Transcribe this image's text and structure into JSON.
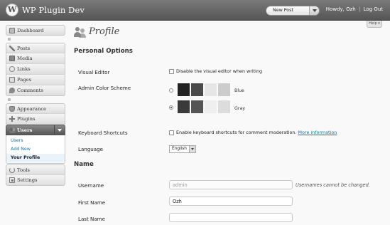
{
  "header": {
    "site_title": "WP Plugin Dev",
    "favorite_action": "New Post",
    "greeting": "Howdy,",
    "user_name": "Ozh",
    "separator": "|",
    "logout": "Log Out",
    "help_tab": "Help"
  },
  "sidebar": {
    "items": [
      {
        "label": "Dashboard",
        "icon": "dashboard-icon"
      },
      {
        "label": "Posts",
        "icon": "posts-icon"
      },
      {
        "label": "Media",
        "icon": "media-icon"
      },
      {
        "label": "Links",
        "icon": "links-icon"
      },
      {
        "label": "Pages",
        "icon": "pages-icon"
      },
      {
        "label": "Comments",
        "icon": "comments-icon"
      },
      {
        "label": "Appearance",
        "icon": "appearance-icon"
      },
      {
        "label": "Plugins",
        "icon": "plugins-icon"
      },
      {
        "label": "Users",
        "icon": "users-icon"
      },
      {
        "label": "Tools",
        "icon": "tools-icon"
      },
      {
        "label": "Settings",
        "icon": "settings-icon"
      }
    ],
    "users_submenu": [
      "Users",
      "Add New",
      "Your Profile"
    ],
    "active_submenu": "Your Profile"
  },
  "main": {
    "page_title": "Profile",
    "personal_options": {
      "section_title": "Personal Options",
      "visual_editor_label": "Visual Editor",
      "visual_editor_checkbox": "Disable the visual editor when writing",
      "color_scheme_label": "Admin Color Scheme",
      "color_schemes": [
        {
          "name": "Blue",
          "selected": false,
          "colors": [
            "#222222",
            "#4a4a4a",
            "#e6e6e6",
            "#cccccc"
          ]
        },
        {
          "name": "Gray",
          "selected": true,
          "colors": [
            "#3a3a3a",
            "#555555",
            "#efefef",
            "#dcdcdc"
          ]
        }
      ],
      "keyboard_label": "Keyboard Shortcuts",
      "keyboard_checkbox": "Enable keyboard shortcuts for comment moderation.",
      "keyboard_link": "More information",
      "language_label": "Language",
      "language_value": "English"
    },
    "name": {
      "section_title": "Name",
      "username_label": "Username",
      "username_value": "admin",
      "username_note": "Usernames cannot be changed.",
      "first_name_label": "First Name",
      "first_name_value": "Ozh",
      "last_name_label": "Last Name",
      "last_name_value": ""
    }
  }
}
